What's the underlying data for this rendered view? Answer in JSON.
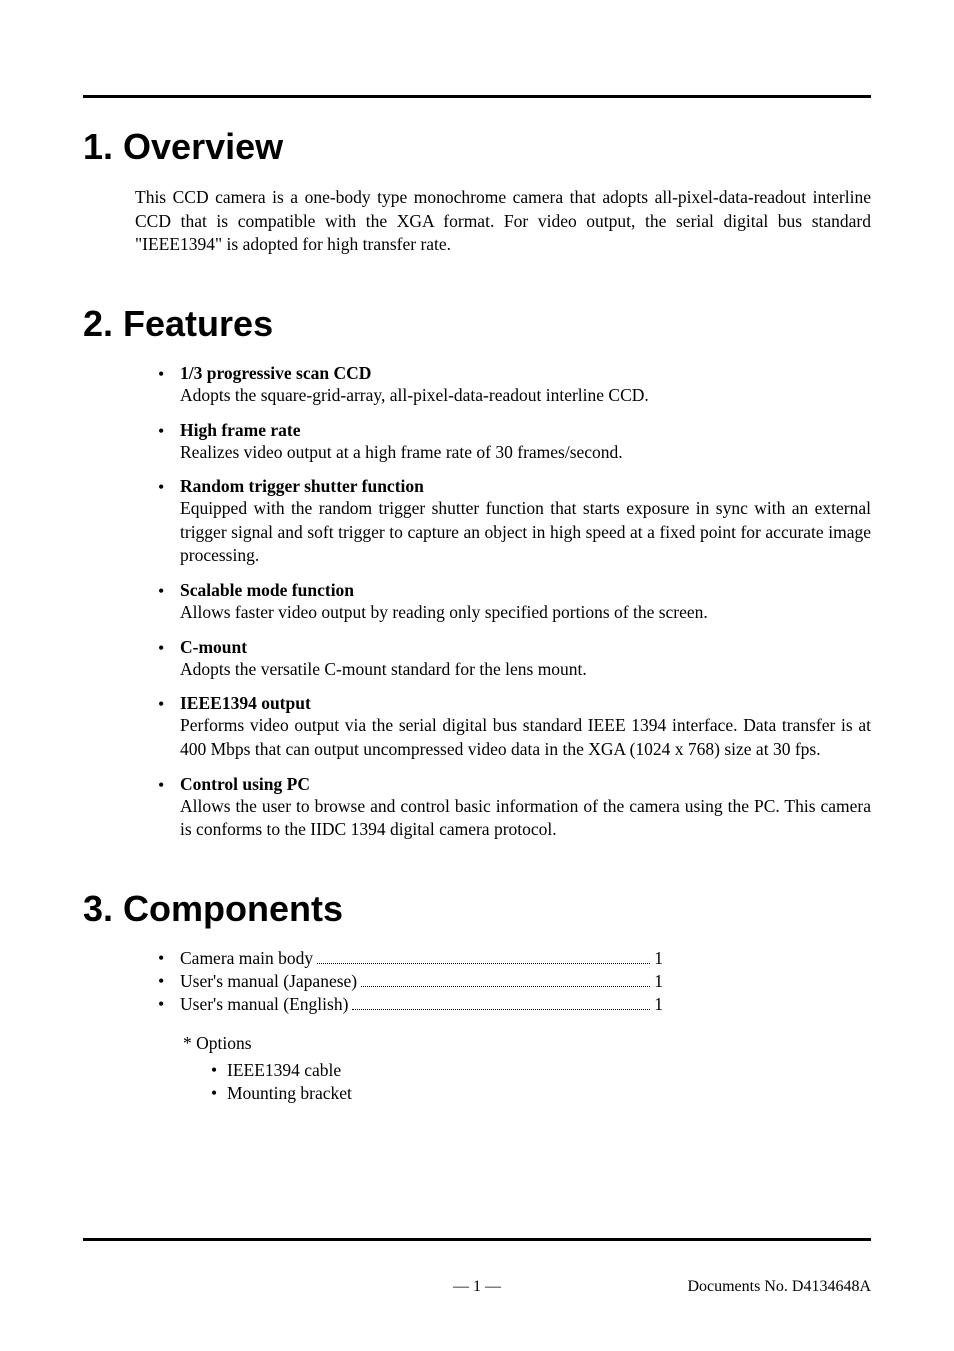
{
  "section1": {
    "title": "1.  Overview",
    "body": "This CCD camera is a one-body type monochrome camera that adopts all-pixel-data-readout interline CCD that is compatible with the XGA format.  For video output, the serial digital bus standard \"IEEE1394\" is adopted for high transfer rate."
  },
  "section2": {
    "title": "2.  Features",
    "items": [
      {
        "title": "1/3 progressive scan CCD",
        "desc": "Adopts the square-grid-array, all-pixel-data-readout interline CCD."
      },
      {
        "title": "High frame rate",
        "desc": "Realizes video output at a high frame rate of 30 frames/second."
      },
      {
        "title": "Random trigger shutter function",
        "desc": "Equipped with the random trigger shutter function that starts exposure in sync with an external trigger signal and soft trigger to capture an object in high speed at a fixed point for accurate image processing."
      },
      {
        "title": "Scalable mode function",
        "desc": "Allows faster video output by reading only specified portions of the screen."
      },
      {
        "title": "C-mount",
        "desc": "Adopts the versatile C-mount standard for the lens mount."
      },
      {
        "title": "IEEE1394 output",
        "desc": "Performs video output via the serial digital bus standard IEEE 1394 interface.  Data transfer is at 400 Mbps that can output uncompressed video data in the XGA (1024 x 768) size at 30 fps."
      },
      {
        "title": "Control using PC",
        "desc": "Allows the user to browse and control basic information of the camera using the PC.  This camera is conforms to the IIDC 1394 digital camera protocol."
      }
    ]
  },
  "section3": {
    "title": "3.  Components",
    "items": [
      {
        "label": "Camera main body",
        "qty": "1"
      },
      {
        "label": "User's manual (Japanese)",
        "qty": "1"
      },
      {
        "label": "User's manual (English)",
        "qty": "1"
      }
    ],
    "options_label": "* Options",
    "options": [
      "IEEE1394 cable",
      "Mounting bracket"
    ]
  },
  "footer": {
    "page": "— 1 —",
    "docno": "Documents No. D4134648A"
  }
}
